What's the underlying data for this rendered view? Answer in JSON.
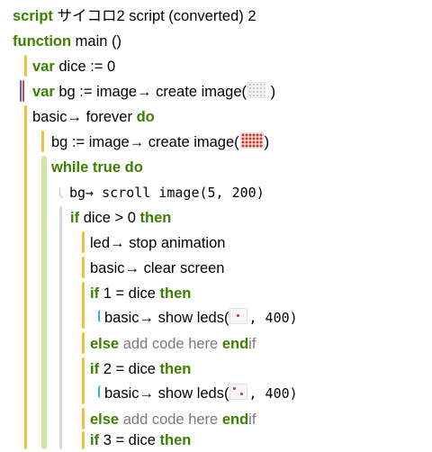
{
  "script": {
    "header_keyword": "script",
    "title": "サイコロ2 script (converted) 2"
  },
  "lines": {
    "function_kw": "function",
    "function_sig": "main ()",
    "var_kw": "var",
    "dice_decl": "dice := 0",
    "bg_decl": "bg := image→ create image(",
    "close_paren": ")",
    "forever": "basic→ forever",
    "do_kw": "do",
    "bg_assign": "bg := image→ create image(",
    "while_kw": "while",
    "true_kw": "true",
    "scroll": "bg→ scroll image(5, 200)",
    "if_kw": "if",
    "then_kw": "then",
    "dice_gt": "dice > 0",
    "stop_anim": "led→ stop animation",
    "clear_screen": "basic→ clear screen",
    "cond1": "1 = dice",
    "show_leds_1": "basic→ show leds(",
    "show_leds_1_arg": ", 400)",
    "else_kw": "else",
    "add_code": "add code here",
    "end_kw": "end",
    "if_plain": "if",
    "cond2": "2 = dice",
    "show_leds_2": "basic→ show leds(",
    "show_leds_2_arg": ", 400)",
    "cond3": "3 = dice"
  },
  "colors": {
    "keyword": "#3c8000",
    "gray_text": "#7a7a7a",
    "bar_yellow": "#f2c13c",
    "bar_green": "#cfe6a3",
    "bar_gray": "#d9d9d9",
    "callout_blue": "#38a9e0",
    "red_marker": "#c0392b"
  }
}
